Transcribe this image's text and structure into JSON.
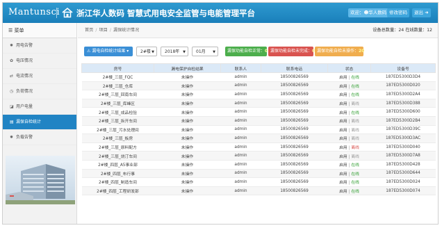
{
  "header": {
    "brand": "Mantunsci",
    "title": "浙江华人数码 智慧式用电安全监管与电能管理平台",
    "welcome": "欢迎：",
    "user": "华人数码",
    "change_password": "修改密码",
    "logout": "退出"
  },
  "sidebar": {
    "menu_label": "菜单",
    "items": [
      {
        "icon": "gear-icon",
        "label": "用电告警"
      },
      {
        "icon": "bolt-icon",
        "label": "电压情况"
      },
      {
        "icon": "swap-icon",
        "label": "电流情况"
      },
      {
        "icon": "clock-icon",
        "label": "负荷情况"
      },
      {
        "icon": "tachometer-icon",
        "label": "用户电量"
      },
      {
        "icon": "chart-icon",
        "label": "漏保自检统计"
      },
      {
        "icon": "gear-icon",
        "label": "负载告警"
      }
    ]
  },
  "breadcrumb": [
    "首页",
    "项目",
    "漏保统计情况"
  ],
  "counts": {
    "total_label": "设备总数量：",
    "total": "24",
    "online_label": "在线数量：",
    "online": "12"
  },
  "toolbar": {
    "export_label": "漏电自检统计结果",
    "floor": "2#楼",
    "year": "2018年",
    "month": "01月",
    "normal_label": "漏保功能自检正常：",
    "normal_count": "0",
    "incomplete_label": "漏保功能自检未完成：",
    "incomplete_count": "0",
    "not_done_label": "漏保功能自检未操作：",
    "not_done_count": "20"
  },
  "table": {
    "headers": [
      "房号",
      "漏电保护自检结果",
      "联系人",
      "联系电话",
      "状态",
      "设备号"
    ],
    "rows": [
      {
        "room": "2#楼_三层_FQC",
        "result": "未操作",
        "contact": "admin",
        "phone": "18500826569",
        "status_a": "启用",
        "status_b": "在线",
        "b_cls": "st-on",
        "device": "187ED5300D3D4"
      },
      {
        "room": "2#楼_三层_仓库",
        "result": "未操作",
        "contact": "admin",
        "phone": "18500826569",
        "status_a": "启用",
        "status_b": "在线",
        "b_cls": "st-on",
        "device": "187ED5300D020"
      },
      {
        "room": "2#楼_三层_回南车间",
        "result": "未操作",
        "contact": "admin",
        "phone": "18500826569",
        "status_a": "启用",
        "status_b": "在线",
        "b_cls": "st-on",
        "device": "187ED5300D2A4"
      },
      {
        "room": "2#楼_三层_库峰区",
        "result": "未操作",
        "contact": "admin",
        "phone": "18500826569",
        "status_a": "启用",
        "status_b": "离线",
        "b_cls": "st-off",
        "device": "187ED5300D388"
      },
      {
        "room": "2#楼_三层_成品检验",
        "result": "未操作",
        "contact": "admin",
        "phone": "18500826569",
        "status_a": "启用",
        "status_b": "在线",
        "b_cls": "st-on",
        "device": "187ED5300D600"
      },
      {
        "room": "2#楼_三层_拆开车间",
        "result": "未操作",
        "contact": "admin",
        "phone": "18500826569",
        "status_a": "启用",
        "status_b": "离线",
        "b_cls": "st-off",
        "device": "187ED5300D2B4"
      },
      {
        "room": "2#楼_三层_污水处理间",
        "result": "未操作",
        "contact": "admin",
        "phone": "18500826569",
        "status_a": "启用",
        "status_b": "离线",
        "b_cls": "st-off",
        "device": "187ED5300D39C"
      },
      {
        "room": "2#楼_三层_板房",
        "result": "未操作",
        "contact": "admin",
        "phone": "18500826569",
        "status_a": "启用",
        "status_b": "离线",
        "b_cls": "st-off",
        "device": "187ED5300D3AC"
      },
      {
        "room": "2#楼_三层_原料配方",
        "result": "未操作",
        "contact": "admin",
        "phone": "18500826569",
        "status_a": "启用",
        "status_b": "离线",
        "b_cls": "st-warn",
        "device": "187ED5300D040"
      },
      {
        "room": "2#楼_三层_烧汀车间",
        "result": "未操作",
        "contact": "admin",
        "phone": "18500826569",
        "status_a": "启用",
        "status_b": "离线",
        "b_cls": "st-off",
        "device": "187ED5300D7A8"
      },
      {
        "room": "2#楼_四层_A5事业部",
        "result": "未操作",
        "contact": "admin",
        "phone": "18500826569",
        "status_a": "启用",
        "status_b": "在线",
        "b_cls": "st-on",
        "device": "187ED5300D428"
      },
      {
        "room": "2#楼_四层_布行事",
        "result": "未操作",
        "contact": "admin",
        "phone": "18500826569",
        "status_a": "启用",
        "status_b": "在线",
        "b_cls": "st-on",
        "device": "187ED5300D644"
      },
      {
        "room": "2#楼_四层_制造车间",
        "result": "未操作",
        "contact": "admin",
        "phone": "18500826569",
        "status_a": "启用",
        "status_b": "在线",
        "b_cls": "st-on",
        "device": "187ED5300D024"
      },
      {
        "room": "2#楼_四层_工程研发部",
        "result": "未操作",
        "contact": "admin",
        "phone": "18500826569",
        "status_a": "启用",
        "status_b": "在线",
        "b_cls": "st-on",
        "device": "187ED5300D074"
      }
    ]
  },
  "colors": {
    "header": "#1f88c3",
    "sidebar_active": "#2184c4",
    "badge_green": "#4cae4c",
    "badge_red": "#d9534f",
    "badge_orange": "#f0ad4e"
  }
}
